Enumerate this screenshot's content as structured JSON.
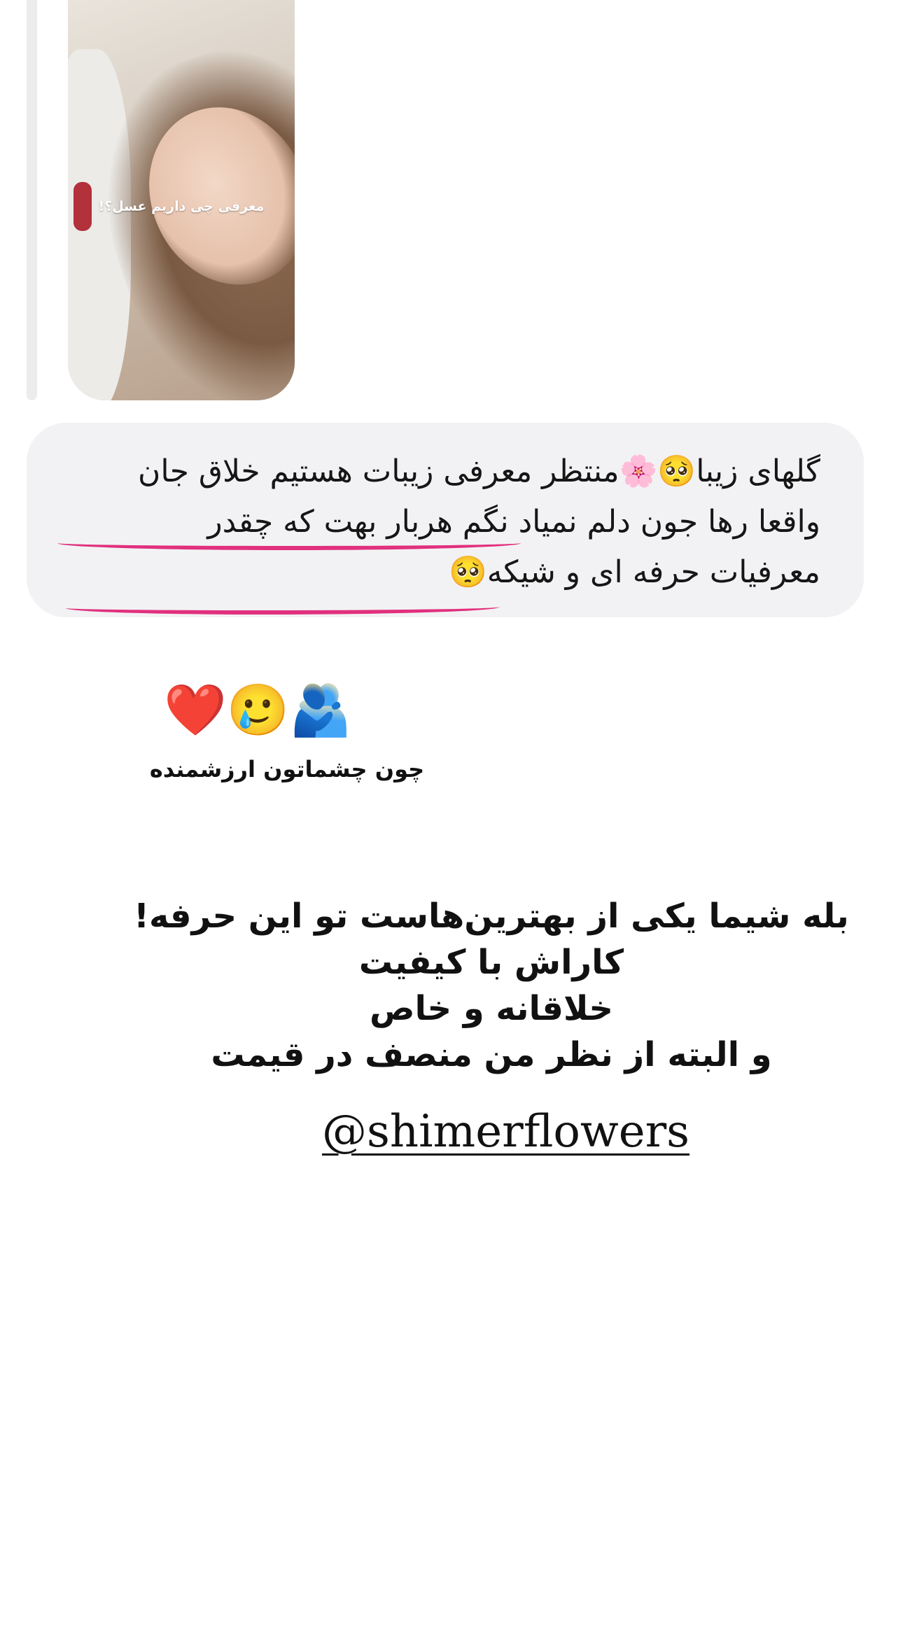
{
  "story_reply": {
    "thumbnail_caption": "معرفی چی داریم عسل؟!",
    "thumbnail_icon": "story-image"
  },
  "message": {
    "lines": [
      "گلهای زیبا🥺🌸منتظر معرفی زیبات هستیم خلاق جان",
      "واقعا رها جون دلم نمیاد نگم هربار بهت که چقدر",
      "معرفیات حرفه ای و شیکه🥺"
    ],
    "underline_color": "#e1307d"
  },
  "reaction": {
    "emojis": "❤️🥲🫂",
    "caption": "چون چشماتون ارزشمنده"
  },
  "story_text": {
    "lines": [
      "بله شیما یکی از بهترین‌هاست تو این حرفه!",
      "کاراش با کیفیت",
      "خلاقانه و خاص",
      "و البته از نظر من منصف در قیمت"
    ]
  },
  "mention": "@shimerflowers"
}
